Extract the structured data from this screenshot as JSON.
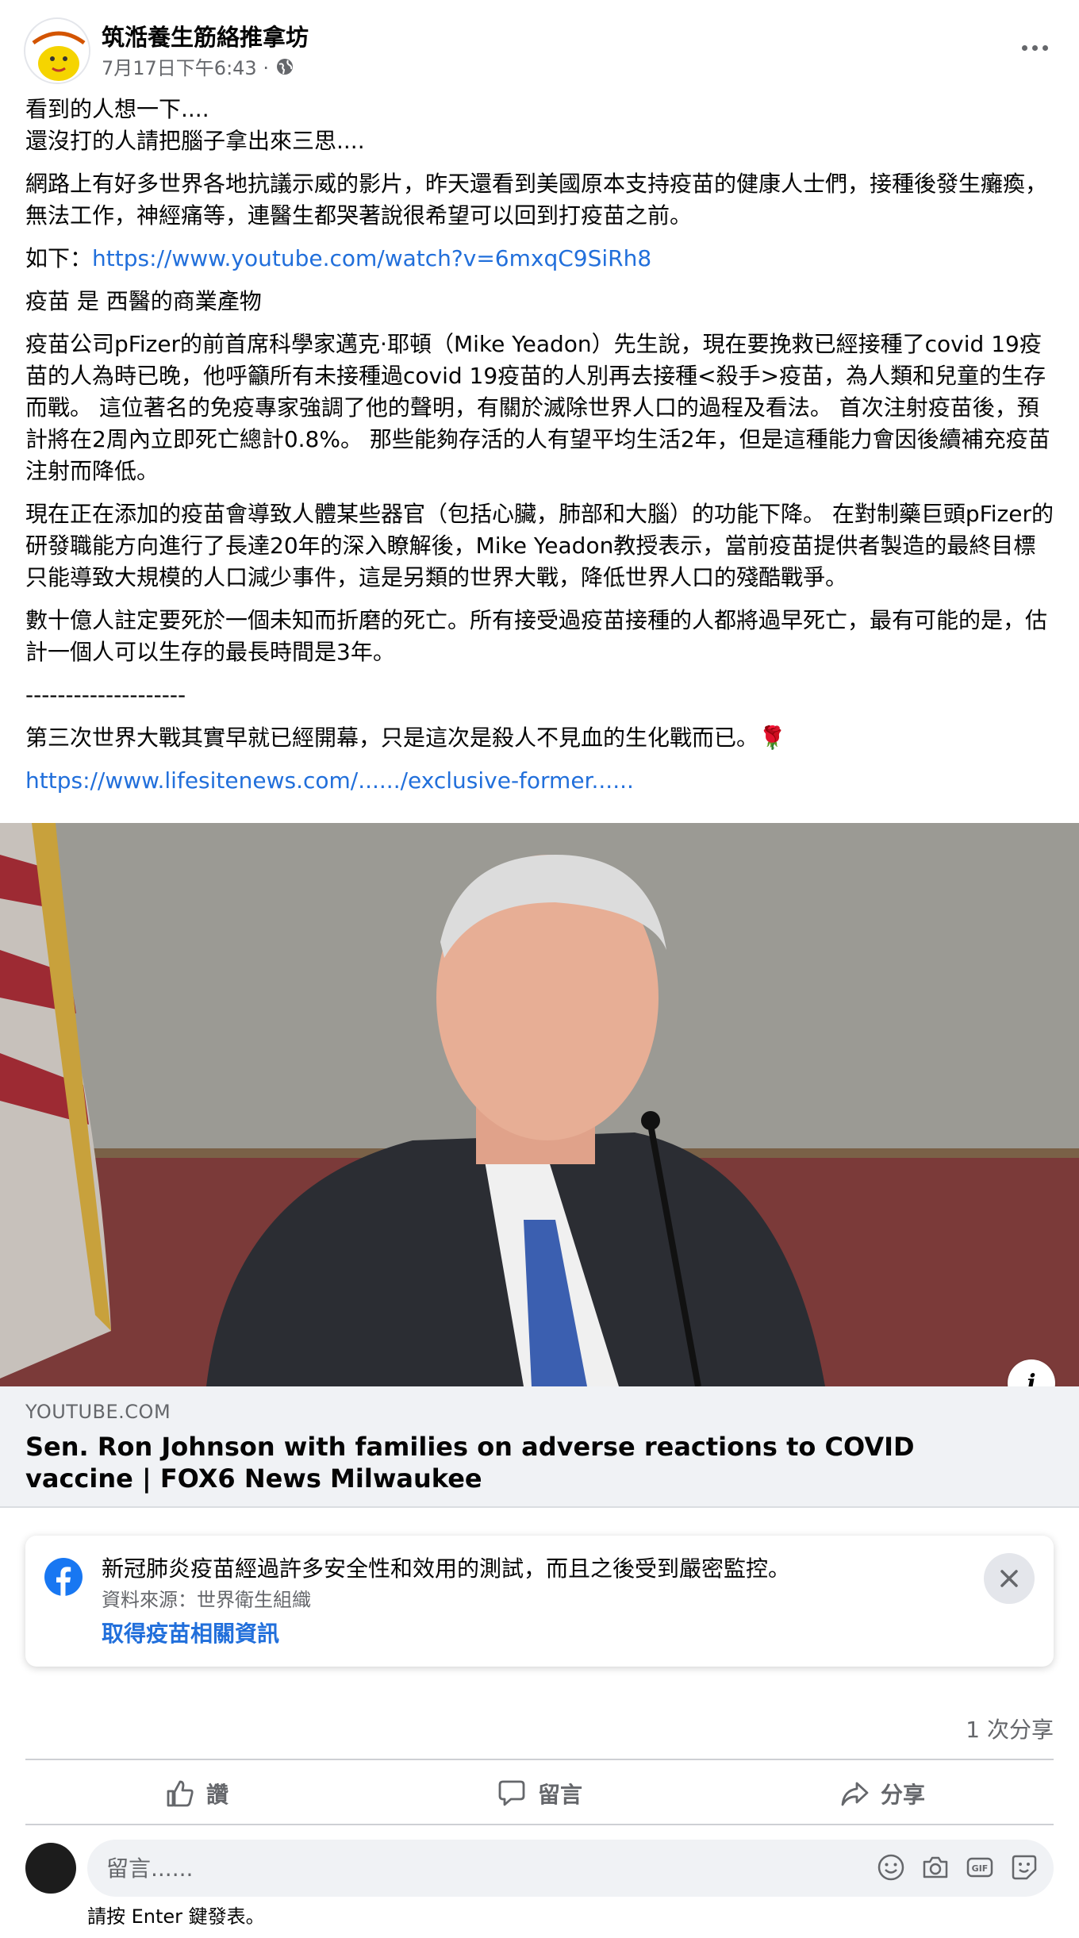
{
  "post": {
    "page_name": "筑湉養生筋絡推拿坊",
    "time": "7月17日下午6:43 ·",
    "paragraphs": [
      {
        "lines": [
          "看到的人想一下....",
          "還沒打的人請把腦子拿出來三思...."
        ]
      },
      {
        "lines": [
          "網路上有好多世界各地抗議示威的影片，昨天還看到美國原本支持疫苗的健康人士們，接種後發生癱瘓，無法工作，神經痛等，連醫生都哭著說很希望可以回到打疫苗之前。"
        ]
      },
      {
        "prefix": "如下：",
        "link": "https://www.youtube.com/watch?v=6mxqC9SiRh8"
      },
      {
        "lines": [
          "疫苗 是 西醫的商業產物"
        ]
      },
      {
        "lines": [
          "疫苗公司pFizer的前首席科學家邁克·耶頓（Mike Yeadon）先生說，現在要挽救已經接種了covid 19疫苗的人為時已晚，他呼籲所有未接種過covid 19疫苗的人別再去接種<殺手>疫苗，為人類和兒童的生存而戰。 這位著名的免疫專家強調了他的聲明，有關於滅除世界人口的過程及看法。 首次注射疫苗後，預計將在2周內立即死亡總計0.8%。 那些能夠存活的人有望平均生活2年，但是這種能力會因後續補充疫苗注射而降低。"
        ]
      },
      {
        "lines": [
          " 現在正在添加的疫苗會導致人體某些器官（包括心臟，肺部和大腦）的功能下降。 在對制藥巨頭pFizer的研發職能方向進行了長達20年的深入瞭解後，Mike Yeadon教授表示，當前疫苗提供者製造的最終目標只能導致大規模的人口減少事件，這是另類的世界大戰，降低世界人口的殘酷戰爭。"
        ]
      },
      {
        "lines": [
          " 數十億人註定要死於一個未知而折磨的死亡。所有接受過疫苗接種的人都將過早死亡，最有可能的是，估計一個人可以生存的最長時間是3年。"
        ]
      },
      {
        "lines": [
          "--------------------"
        ]
      },
      {
        "lines": [
          "第三次世界大戰其實早就已經開幕，只是這次是殺人不見血的生化戰而已。🌹"
        ]
      },
      {
        "prefix": " ",
        "link": "https://www.lifesitenews.com/....../exclusive-former......"
      }
    ]
  },
  "link_card": {
    "domain": "YOUTUBE.COM",
    "title": "Sen. Ron Johnson with families on adverse reactions to COVID vaccine | FOX6 News Milwaukee"
  },
  "covid_info": {
    "text": "新冠肺炎疫苗經過許多安全性和效用的測試，而且之後受到嚴密監控。",
    "source": "資料來源：世界衛生組織",
    "link": "取得疫苗相關資訊"
  },
  "stats": {
    "shares": "1 次分享"
  },
  "actions": {
    "like": "讚",
    "comment": "留言",
    "share": "分享"
  },
  "comment_box": {
    "placeholder": "留言......",
    "hint": "請按 Enter 鍵發表。"
  },
  "colors": {
    "link": "#216fdb",
    "secondary_text": "#65676b",
    "card_bg": "#f0f2f5",
    "facebook_blue": "#1877f2"
  }
}
